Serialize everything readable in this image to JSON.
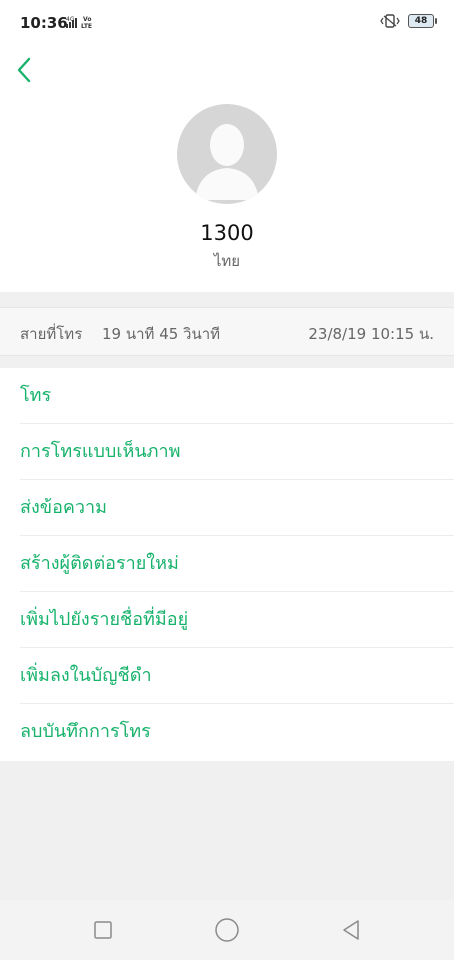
{
  "status_bar": {
    "time": "10:36",
    "network_top": "4G",
    "network_bottom": "Vo LTE",
    "battery": "48"
  },
  "contact": {
    "name": "1300",
    "subtitle": "ไทย"
  },
  "call_log": {
    "type": "สายที่โทร",
    "duration": "19 นาที 45 วินาที",
    "datetime": "23/8/19 10:15 น."
  },
  "actions": [
    {
      "label": "โทร"
    },
    {
      "label": "การโทรแบบเห็นภาพ"
    },
    {
      "label": "ส่งข้อความ"
    },
    {
      "label": "สร้างผู้ติดต่อรายใหม่"
    },
    {
      "label": "เพิ่มไปยังรายชื่อที่มีอยู่"
    },
    {
      "label": "เพิ่มลงในบัญชีดำ"
    },
    {
      "label": "ลบบันทึกการโทร"
    }
  ],
  "colors": {
    "accent": "#17b26b",
    "avatar_bg": "#d6d6d6"
  },
  "icons": {
    "back": "chevron-left-icon",
    "vibrate": "vibrate-icon",
    "signal": "signal-icon",
    "nav_recent": "square-icon",
    "nav_home": "circle-icon",
    "nav_back": "triangle-icon"
  }
}
